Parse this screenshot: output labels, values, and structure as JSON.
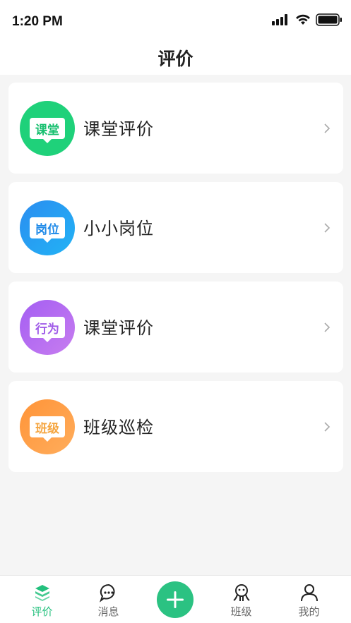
{
  "status_bar": {
    "time": "1:20 PM"
  },
  "nav": {
    "title": "评价"
  },
  "cards": [
    {
      "badge": "课堂",
      "label": "课堂评价",
      "color": "#1fcf79",
      "badge_color": "#19c070"
    },
    {
      "badge": "岗位",
      "label": "小小岗位",
      "color": "#2597f0",
      "badge_color": "#1f8ae8"
    },
    {
      "badge": "行为",
      "label": "课堂评价",
      "color": "#b16cf0",
      "badge_color": "#a05ce8"
    },
    {
      "badge": "班级",
      "label": "班级巡检",
      "color": "#ff9f45",
      "badge_color": "#f5a641"
    }
  ],
  "tabs": [
    {
      "label": "评价",
      "icon": "evaluate-icon",
      "active": true
    },
    {
      "label": "消息",
      "icon": "message-icon",
      "active": false
    },
    {
      "label": "",
      "icon": "add-icon",
      "active": false
    },
    {
      "label": "班级",
      "icon": "class-icon",
      "active": false
    },
    {
      "label": "我的",
      "icon": "profile-icon",
      "active": false
    }
  ],
  "colors": {
    "accent": "#23c07d"
  }
}
